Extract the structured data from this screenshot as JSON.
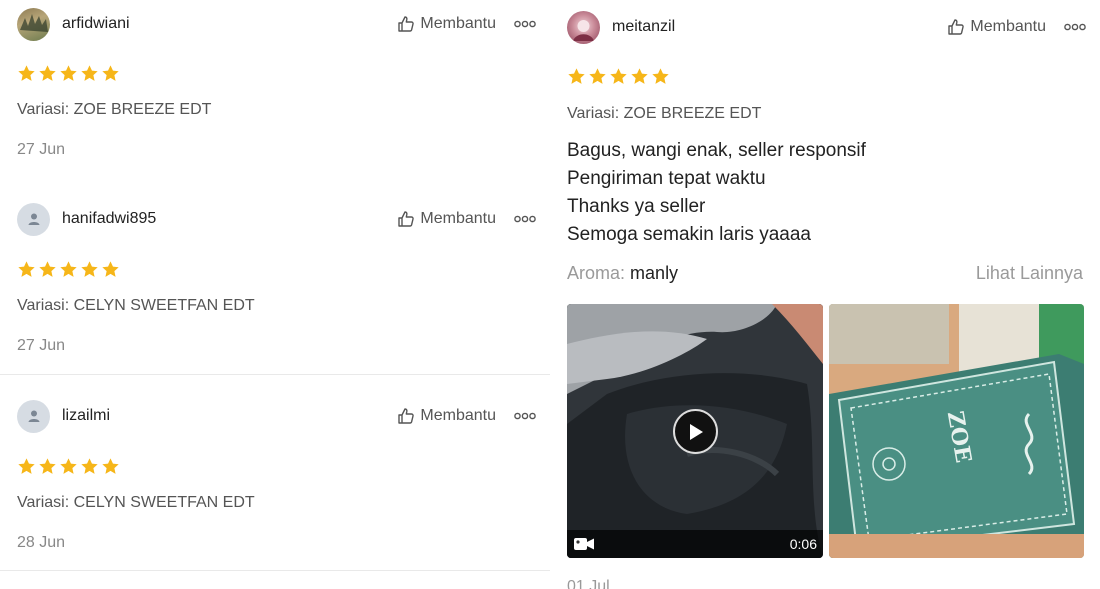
{
  "reviews_left": [
    {
      "username": "arfidwiani",
      "helpful_label": "Membantu",
      "rating": 5,
      "variant": "Variasi: ZOE BREEZE EDT",
      "date": "27 Jun"
    },
    {
      "username": "hanifadwi895",
      "helpful_label": "Membantu",
      "rating": 5,
      "variant": "Variasi: CELYN SWEETFAN EDT",
      "date": "27 Jun"
    },
    {
      "username": "lizailmi",
      "helpful_label": "Membantu",
      "rating": 5,
      "variant": "Variasi: CELYN SWEETFAN EDT",
      "date": "28 Jun"
    }
  ],
  "review_right": {
    "username": "meitanzil",
    "helpful_label": "Membantu",
    "rating": 5,
    "variant": "Variasi: ZOE BREEZE EDT",
    "comment_lines": [
      "Bagus, wangi enak, seller responsif",
      "Pengiriman tepat waktu",
      "Thanks ya seller",
      "Semoga semakin laris yaaaa"
    ],
    "aroma_key": "Aroma:",
    "aroma_value": "manly",
    "see_more": "Lihat Lainnya",
    "video_duration": "0:06",
    "photo_text": "ZOE",
    "date": "01 Jul"
  },
  "colors": {
    "star": "#f6b619",
    "helpful_text": "#555555",
    "muted": "#888888"
  },
  "icons": [
    "thumbs-up-icon",
    "more-options-icon",
    "star-icon",
    "play-icon",
    "video-camera-icon",
    "default-avatar-icon"
  ]
}
